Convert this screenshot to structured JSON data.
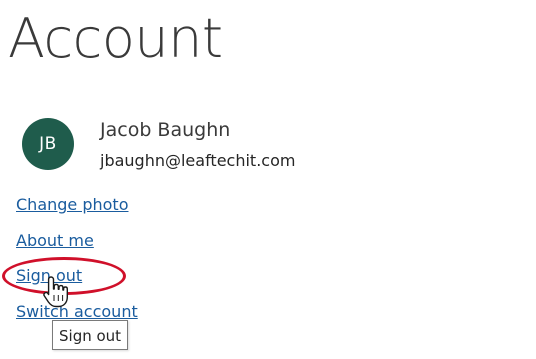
{
  "page": {
    "title": "Account"
  },
  "account": {
    "avatar_initials": "JB",
    "name": "Jacob Baughn",
    "email": "jbaughn@leaftechit.com"
  },
  "links": {
    "change_photo": "Change photo",
    "about_me": "About me",
    "sign_out": "Sign out",
    "switch_account": "Switch account"
  },
  "tooltip": {
    "text": "Sign out"
  },
  "annotation": {
    "highlight_color": "#d0102a",
    "highlighted_item": "Sign out"
  },
  "colors": {
    "avatar_bg": "#1f5c4c",
    "link": "#1a5c9e"
  },
  "cursor": {
    "icon": "hand-pointer-icon"
  }
}
